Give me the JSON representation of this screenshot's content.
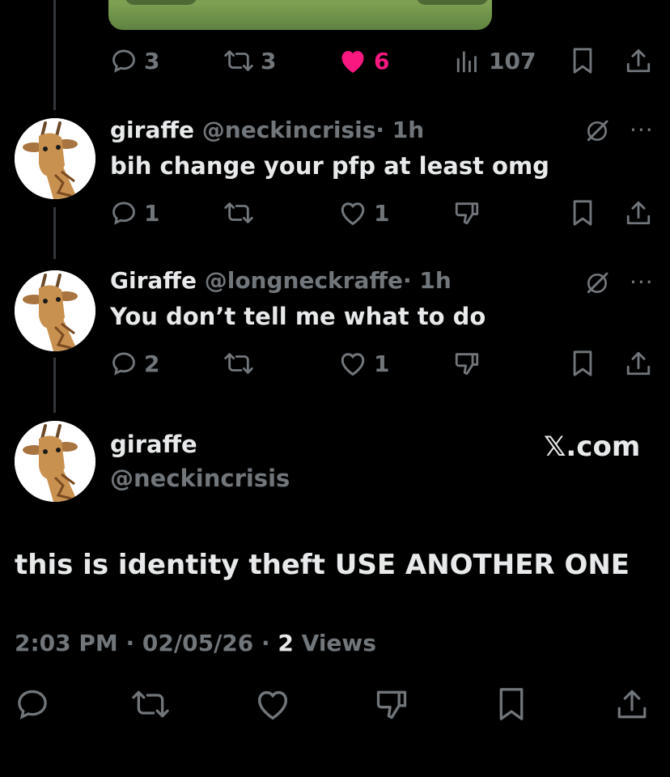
{
  "top_tweet": {
    "actions": {
      "replies": "3",
      "retweets": "3",
      "likes": "6",
      "views": "107"
    }
  },
  "reply1": {
    "display_name": "giraffe",
    "handle": "@neckincrisis",
    "time": "· 1h",
    "text": "bih change your pfp at least omg",
    "actions": {
      "replies": "1",
      "retweets": "",
      "likes": "1"
    }
  },
  "reply2": {
    "display_name": "Giraffe",
    "handle": "@longneckraffe",
    "time": "· 1h",
    "text": "You don’t tell me what to do",
    "actions": {
      "replies": "2",
      "retweets": "",
      "likes": "1"
    }
  },
  "main_tweet": {
    "display_name": "giraffe",
    "handle": "@neckincrisis",
    "watermark": "𝕏.com",
    "text": "this is identity theft USE ANOTHER ONE",
    "time": "2:03 PM",
    "date": "02/05/26",
    "views_count": "2",
    "views_label": "Views"
  },
  "colors": {
    "background": "#000000",
    "muted": "#71767b",
    "text": "#e7e9ea",
    "like_active": "#f91880",
    "thread_line": "#333639"
  },
  "icons": [
    "reply-icon",
    "retweet-icon",
    "like-icon",
    "views-icon",
    "bookmark-icon",
    "share-icon",
    "dislike-icon",
    "grok-icon",
    "more-icon"
  ]
}
